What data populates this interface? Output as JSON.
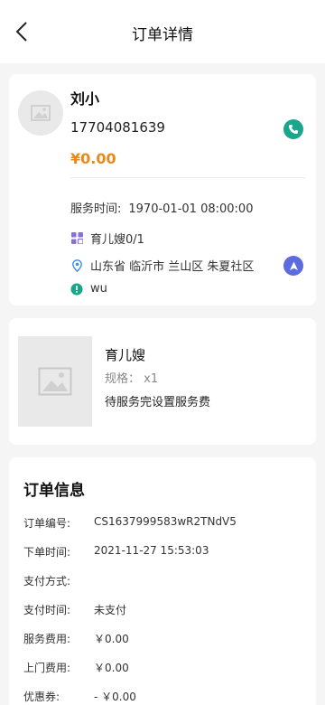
{
  "header": {
    "title": "订单详情"
  },
  "customer": {
    "name": "刘小",
    "phone": "17704081639",
    "price": "¥0.00",
    "service_time_label": "服务时间:",
    "service_time_value": "1970-01-01 08:00:00",
    "service_type": "育儿嫂0/1",
    "address": "山东省 临沂市 兰山区 朱夏社区",
    "note": "wu"
  },
  "product": {
    "name": "育儿嫂",
    "spec": "规格： x1",
    "status": "待服务完设置服务费"
  },
  "order_info": {
    "title": "订单信息",
    "rows": [
      {
        "label": "订单编号:",
        "value": "CS1637999583wR2TNdV5"
      },
      {
        "label": "下单时间:",
        "value": "2021-11-27 15:53:03"
      },
      {
        "label": "支付方式:",
        "value": ""
      },
      {
        "label": "支付时间:",
        "value": "未支付"
      },
      {
        "label": "服务费用:",
        "value": "￥0.00"
      },
      {
        "label": "上门费用:",
        "value": "￥0.00"
      },
      {
        "label": "优惠券:",
        "value": "- ￥0.00"
      }
    ]
  },
  "colors": {
    "price": "#e88a1a",
    "call": "#1aa68a",
    "navigate": "#5b6cde",
    "type_icon": "#8a6fd8",
    "location_icon": "#3a8ee6",
    "note_icon": "#1aa68a"
  }
}
